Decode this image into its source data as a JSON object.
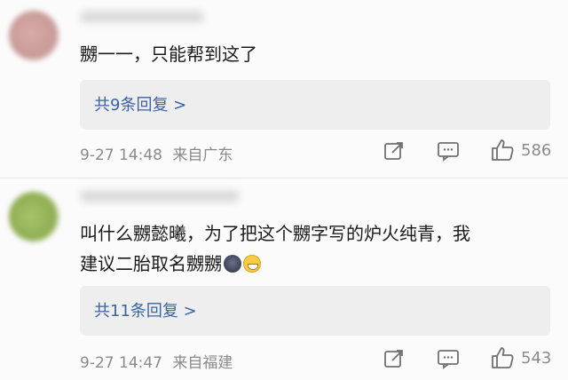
{
  "comments": [
    {
      "text": "嬲一一，只能帮到这了",
      "replies_label": "共9条回复 >",
      "date": "9-27 14:48",
      "location": "来自广东",
      "likes": "586"
    },
    {
      "text_line1": "叫什么嬲懿曦，为了把这个嬲字写的炉火纯青，我",
      "text_line2": "建议二胎取名嬲嬲",
      "replies_label": "共11条回复 >",
      "date": "9-27 14:47",
      "location": "来自福建",
      "likes": "543"
    }
  ],
  "icons": [
    "share-icon",
    "comment-icon",
    "like-icon"
  ]
}
